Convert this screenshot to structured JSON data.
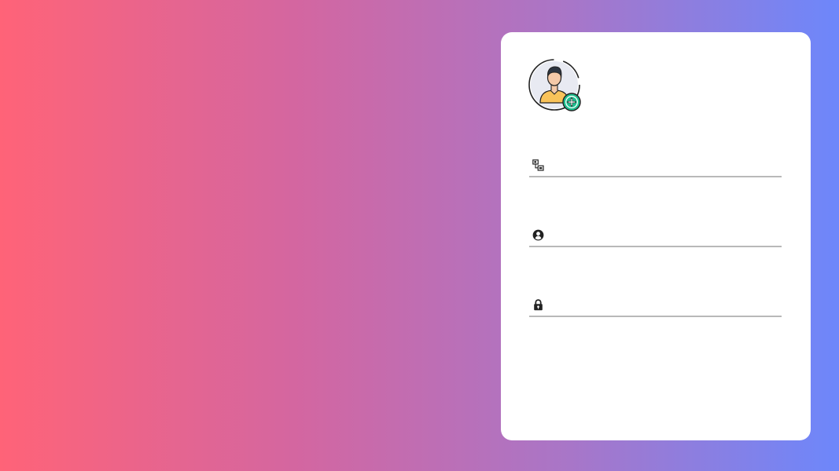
{
  "theme": {
    "gradient_start": "#ff6378",
    "gradient_end": "#6d87fb",
    "card_background": "#ffffff",
    "underline_color": "#b9b9b9",
    "avatar_shirt_color": "#f9c35a",
    "avatar_badge_color": "#1fbf8f"
  },
  "avatar": {
    "icon": "add-user-avatar-icon"
  },
  "form": {
    "fields": [
      {
        "icon": "id-badge-icon",
        "value": "",
        "placeholder": ""
      },
      {
        "icon": "user-circle-icon",
        "value": "",
        "placeholder": ""
      },
      {
        "icon": "lock-icon",
        "value": "",
        "placeholder": ""
      }
    ]
  }
}
